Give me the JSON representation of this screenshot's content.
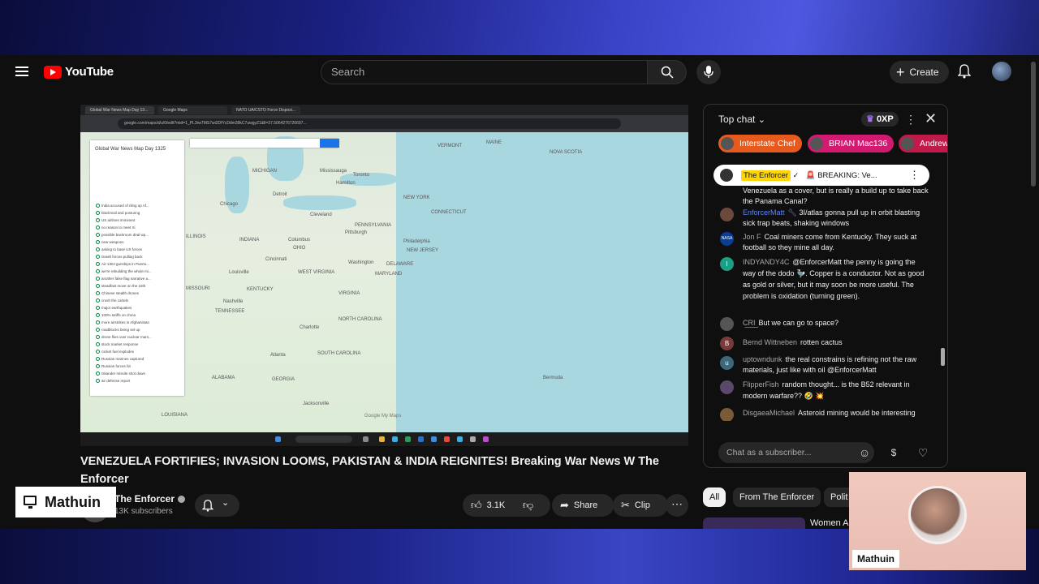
{
  "header": {
    "logo_text": "YouTube",
    "search_placeholder": "Search",
    "create_label": "Create"
  },
  "browser_capture": {
    "tabs": [
      "Global War News Map Day 13...",
      "Google Maps",
      "NATO UA/CSTO Force Disposi..."
    ],
    "url": "google.com/maps/d/u/0/edit?mid=1_PL3rw7MS7wi2DfYcDdm39kC7uwgyZ1&ll=37.5064276726697...",
    "panel_title": "Global War News Map Day 1325",
    "panel_items": [
      "India accused of riling up Af...",
      "blackmail and posturing",
      "US airlines imminent",
      "no reason to meet Xi",
      "possible backroom deal wp...",
      "new weapons",
      "asking to base US forces",
      "Israeli forces pulling back",
      "Air-130J gunships in Puerto...",
      "we're rebuilding the whole mi...",
      "another false flag narrative a...",
      "steadfast move on the 15th",
      "Chinese stealth drones",
      "crush the cartels",
      "major earthquakes",
      "100% tariffs on china",
      "more airstrikes in Afghanistan",
      "roadblocks being set up",
      "drone flies over nuclear mars...",
      "stock market response",
      "rocket fuel explodes",
      "Russian marines captured",
      "Russian forces hit",
      "Iskander missile shot down",
      "air defense report"
    ],
    "map_labels": [
      "MICHIGAN",
      "Mississauga",
      "Toronto",
      "Hamilton",
      "Detroit",
      "Chicago",
      "Cleveland",
      "Pittsburgh",
      "ILLINOIS",
      "Columbus",
      "OHIO",
      "INDIANA",
      "Cincinnati",
      "Philadelphia",
      "NEW JERSEY",
      "PENNSYLVANIA",
      "Washington",
      "DELAWARE",
      "MARYLAND",
      "WEST VIRGINIA",
      "VIRGINIA",
      "KENTUCKY",
      "Louisville",
      "Nashville",
      "TENNESSEE",
      "NORTH CAROLINA",
      "Charlotte",
      "SOUTH CAROLINA",
      "Atlanta",
      "GEORGIA",
      "Jacksonville",
      "Bermuda",
      "NEW YORK",
      "VERMONT",
      "MAINE",
      "NOVA SCOTIA",
      "CONNECTICUT",
      "ALABAMA",
      "LOUISIANA",
      "MISSOURI",
      "Google My Maps"
    ],
    "search_box_label": "Search"
  },
  "video": {
    "title": "VENEZUELA FORTIFIES; INVASION LOOMS, PAKISTAN & INDIA REIGNITES! Breaking War News W The Enforcer",
    "channel_name": "The Enforcer",
    "subscribers": "13K subscribers",
    "likes": "3.1K",
    "share_label": "Share",
    "clip_label": "Clip"
  },
  "chat": {
    "header": "Top chat",
    "xp": "0XP",
    "donors": [
      "Interstate Chef",
      "BRIAN Mac136",
      "Andrew"
    ],
    "pinned": {
      "name": "The Enforcer",
      "text": "🚨 BREAKING: Ve..."
    },
    "messages": [
      {
        "author": "",
        "text": "Venezuela as a cover, but is really a build up to take back the Panama Canal?"
      },
      {
        "author": "EnforcerMatt",
        "text": "3I/atlas gonna pull up in orbit blasting sick trap beats, shaking windows"
      },
      {
        "author": "Jon F",
        "text": "Coal miners come from Kentucky. They suck at football so they mine all day."
      },
      {
        "author": "INDYANDY4C",
        "text": "@EnforcerMatt the penny is going the way of the dodo 🦤. Copper is a conductor. Not as good as gold or silver, but it may soon be more useful. The problem is oxidation (turning green)."
      },
      {
        "author": "C͟R͟I͟",
        "text": "But we can go to space?"
      },
      {
        "author": "Bernd Wittneben",
        "text": "rotten cactus"
      },
      {
        "author": "uptowndunk",
        "text": "the real constrains is refining not the raw materials, just like with oil @EnforcerMatt"
      },
      {
        "author": "FlipperFish",
        "text": "random thought... is the B52 relevant in modern warfare?? 🤣 💥"
      },
      {
        "author": "DisgaeaMichael",
        "text": "Asteroid mining would be interesting"
      }
    ],
    "input_placeholder": "Chat as a subscriber..."
  },
  "filters": [
    "All",
    "From The Enforcer",
    "Polit"
  ],
  "recommendation": {
    "title": "Women A"
  },
  "overlay": {
    "watermark": "Mathuin",
    "cam_label": "Mathuin"
  },
  "colors": {
    "accent_red": "#ff0000",
    "chip_active": "#f1f1f1",
    "pinned_highlight": "#ffd600",
    "author_blue": "#5e84f1"
  }
}
